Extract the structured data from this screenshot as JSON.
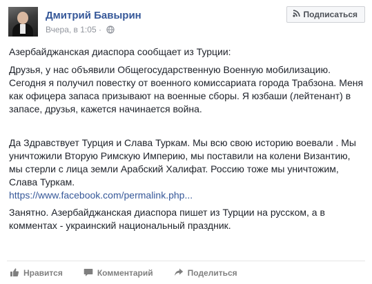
{
  "author": {
    "name": "Дмитрий Бавырин",
    "timestamp": "Вчера, в 1:05 ·"
  },
  "subscribe_label": "Подписаться",
  "post": {
    "intro": "Азербайджанская диаспора сообщает из Турции:",
    "message1": "Друзья, у нас объявили Общегосударственную Военную мобилизацию. Сегодня я получил повестку от военного комиссариата города Трабзона. Меня как офицера запаса призывают на военные сборы. Я юзбаши (лейтенант) в запасе, друзья, кажется начинается война.",
    "message2": "Да Здравствует Турция и Слава Туркам. Мы всю свою историю воевали . Мы уничтожили Вторую Римскую Империю, мы поставили на колени Византию, мы стерли с лица земли Арабский Халифат. Россию тоже мы уничтожим, Слава Туркам.",
    "link": "https://www.facebook.com/permalink.php...",
    "comment": "Занятно. Азербайджанская диаспора пишет из Турции на русском, а в комментах - украинский национальный праздник."
  },
  "actions": {
    "like": "Нравится",
    "comment": "Комментарий",
    "share": "Поделиться"
  },
  "icons": {
    "subscribe": "rss-icon",
    "privacy": "globe-icon",
    "like": "thumbs-up-icon",
    "comment": "comment-icon",
    "share": "share-arrow-icon"
  },
  "colors": {
    "author_name": "#365899",
    "link": "#365899",
    "meta": "#90949c",
    "action_text": "#7f7f7f"
  }
}
